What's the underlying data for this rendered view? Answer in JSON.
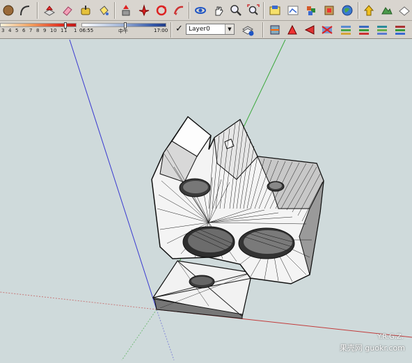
{
  "shadow_settings": {
    "month_scale": [
      "3",
      "4",
      "5",
      "6",
      "7",
      "8",
      "9",
      "10",
      "11",
      "1"
    ],
    "start_time": "06:55",
    "noon_label": "中午",
    "end_time": "17:00"
  },
  "layers": {
    "current_layer": "Layer0",
    "visible_checked": "✓"
  },
  "watermark": {
    "line1": "Y.R.G.Z.",
    "line2": "果壳网 guokr.com"
  },
  "colors": {
    "background": "#cfdadb",
    "toolbar": "#d9d5cf",
    "axis_red": "#c23b3b",
    "axis_green": "#3aa83a",
    "axis_blue": "#3a3ad0"
  },
  "toolbar_icons": [
    "circle-icon",
    "arc-icon",
    "push-pull-icon",
    "eraser-icon",
    "tape-measure-icon",
    "paint-bucket-icon",
    "move-icon",
    "rotate-icon",
    "follow-me-icon",
    "orbit-icon",
    "pan-icon",
    "zoom-icon",
    "zoom-extents-icon",
    "get-models-icon",
    "share-model-icon",
    "components-icon",
    "google-earth-icon",
    "add-location-icon",
    "toggle-terrain-icon",
    "photo-textures-icon"
  ]
}
